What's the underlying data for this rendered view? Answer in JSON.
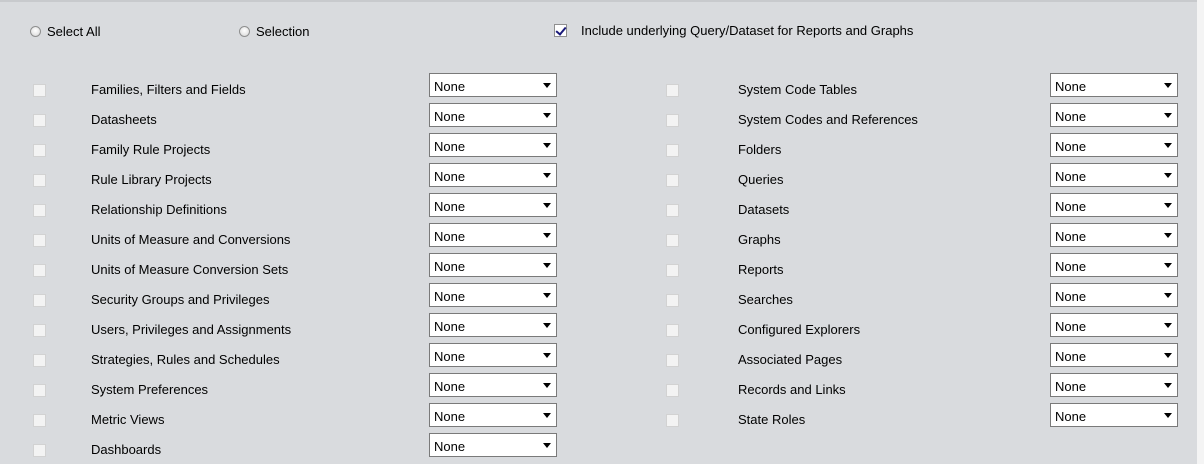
{
  "top_options": {
    "select_all_label": "Select All",
    "selection_label": "Selection",
    "include_label": "Include underlying Query/Dataset for Reports and Graphs",
    "include_checked": true
  },
  "left_items": [
    {
      "label": "Families, Filters and Fields",
      "value": "None"
    },
    {
      "label": "Datasheets",
      "value": "None"
    },
    {
      "label": "Family Rule Projects",
      "value": "None"
    },
    {
      "label": "Rule Library Projects",
      "value": "None"
    },
    {
      "label": "Relationship Definitions",
      "value": "None"
    },
    {
      "label": "Units of Measure and Conversions",
      "value": "None"
    },
    {
      "label": "Units of Measure Conversion Sets",
      "value": "None"
    },
    {
      "label": "Security Groups and Privileges",
      "value": "None"
    },
    {
      "label": "Users, Privileges and Assignments",
      "value": "None"
    },
    {
      "label": "Strategies, Rules and Schedules",
      "value": "None"
    },
    {
      "label": "System Preferences",
      "value": "None"
    },
    {
      "label": "Metric Views",
      "value": "None"
    },
    {
      "label": "Dashboards",
      "value": "None"
    }
  ],
  "right_items": [
    {
      "label": "System Code Tables",
      "value": "None"
    },
    {
      "label": "System Codes and References",
      "value": "None"
    },
    {
      "label": "Folders",
      "value": "None"
    },
    {
      "label": "Queries",
      "value": "None"
    },
    {
      "label": "Datasets",
      "value": "None"
    },
    {
      "label": "Graphs",
      "value": "None"
    },
    {
      "label": "Reports",
      "value": "None"
    },
    {
      "label": "Searches",
      "value": "None"
    },
    {
      "label": "Configured Explorers",
      "value": "None"
    },
    {
      "label": "Associated Pages",
      "value": "None"
    },
    {
      "label": "Records and Links",
      "value": "None"
    },
    {
      "label": "State Roles",
      "value": "None"
    }
  ]
}
